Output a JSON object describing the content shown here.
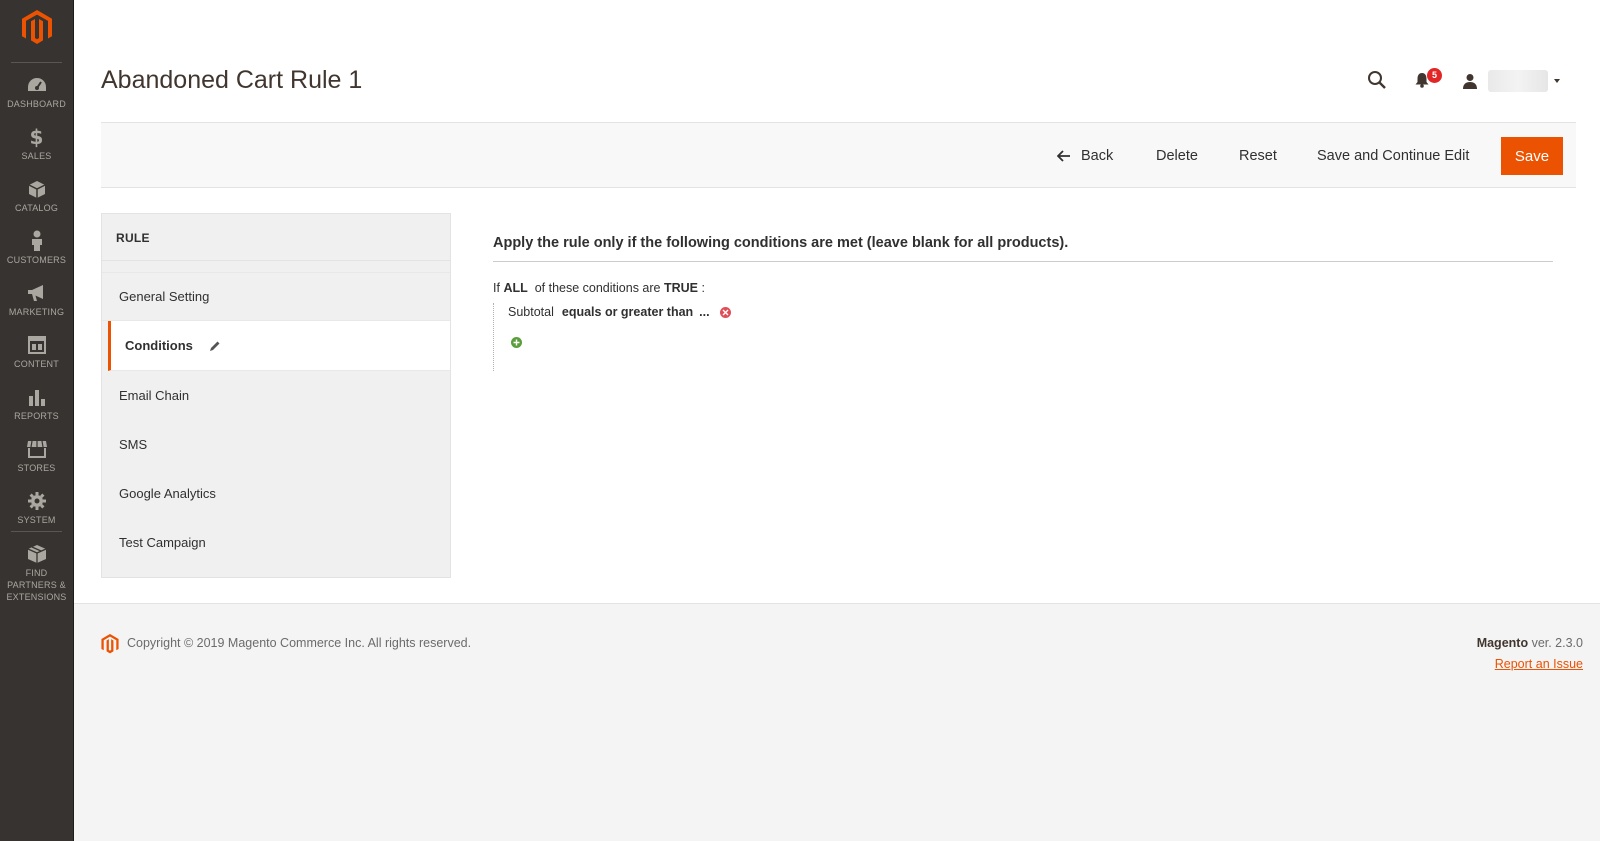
{
  "sidebar": {
    "logo_icon": "magento-logo-icon",
    "items": [
      {
        "label": "DASHBOARD",
        "icon": "dashboard-icon"
      },
      {
        "label": "SALES",
        "icon": "dollar-icon"
      },
      {
        "label": "CATALOG",
        "icon": "cube-icon"
      },
      {
        "label": "CUSTOMERS",
        "icon": "person-icon"
      },
      {
        "label": "MARKETING",
        "icon": "megaphone-icon"
      },
      {
        "label": "CONTENT",
        "icon": "layout-icon"
      },
      {
        "label": "REPORTS",
        "icon": "bar-chart-icon"
      },
      {
        "label": "STORES",
        "icon": "storefront-icon"
      },
      {
        "label": "SYSTEM",
        "icon": "gear-icon"
      }
    ],
    "extensions": {
      "line1": "FIND",
      "line2": "PARTNERS &",
      "line3": "EXTENSIONS",
      "icon": "box-icon"
    }
  },
  "header": {
    "title": "Abandoned Cart Rule 1",
    "notifications_count": "5"
  },
  "actions": {
    "back": "Back",
    "delete": "Delete",
    "reset": "Reset",
    "save_continue": "Save and Continue Edit",
    "save": "Save"
  },
  "tabs": {
    "heading": "RULE",
    "items": [
      {
        "label": "General Setting"
      },
      {
        "label": "Conditions"
      },
      {
        "label": "Email Chain"
      },
      {
        "label": "SMS"
      },
      {
        "label": "Google Analytics"
      },
      {
        "label": "Test Campaign"
      }
    ]
  },
  "conditions": {
    "title": "Apply the rule only if the following conditions are met (leave blank for all products).",
    "prefix": "If",
    "aggregator": "ALL",
    "middle": "of these conditions are",
    "value": "TRUE",
    "suffix": ":",
    "row": {
      "attribute": "Subtotal",
      "operator": "equals or greater than",
      "value": "..."
    }
  },
  "footer": {
    "copyright": "Copyright © 2019 Magento Commerce Inc. All rights reserved.",
    "brand": "Magento",
    "version": "ver. 2.3.0",
    "report": "Report an Issue"
  },
  "colors": {
    "accent": "#eb5202",
    "sidebar_bg": "#373330"
  }
}
